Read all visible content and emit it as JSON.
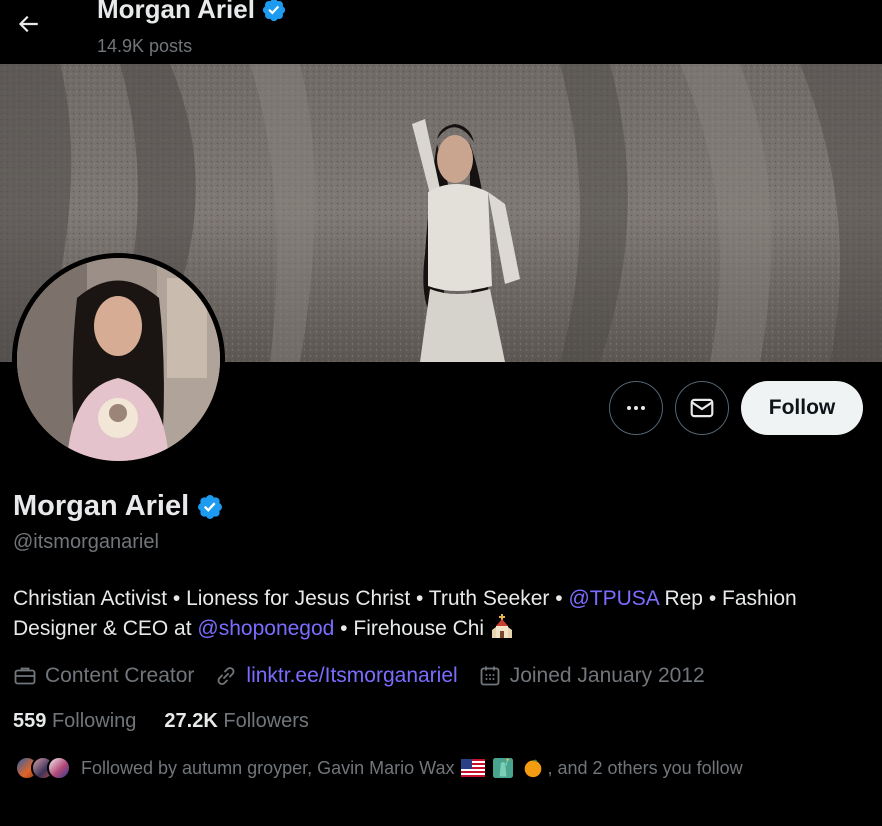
{
  "header": {
    "display_name": "Morgan Ariel",
    "posts_count": "14.9K posts"
  },
  "actions": {
    "follow_label": "Follow"
  },
  "profile": {
    "display_name": "Morgan Ariel",
    "handle": "@itsmorganariel",
    "bio": {
      "part1": "Christian Activist • Lioness for Jesus Christ • Truth Seeker • ",
      "mention1": "@TPUSA",
      "part2": " Rep • Fashion Designer & CEO at ",
      "mention2": "@shoponegod",
      "part3": " • Firehouse Chi "
    },
    "meta": {
      "category": "Content Creator",
      "link": "linktr.ee/Itsmorganariel",
      "joined": "Joined January 2012"
    },
    "stats": {
      "following_count": "559",
      "following_label": "Following",
      "followers_count": "27.2K",
      "followers_label": "Followers"
    },
    "followed_by": {
      "prefix": "Followed by autumn groyper, Gavin Mario Wax",
      "suffix": ", and 2 others you follow"
    }
  },
  "colors": {
    "background": "#000000",
    "text": "#e7e9ea",
    "secondary_text": "#71767b",
    "link": "#7b6cff",
    "verified": "#1d9bf0",
    "follow_button_bg": "#eff3f4"
  },
  "icons": {
    "back": "arrow-left-icon",
    "verified": "verified-badge-icon",
    "more": "more-horizontal-icon",
    "message": "envelope-icon",
    "category": "briefcase-icon",
    "link": "link-icon",
    "joined": "calendar-icon"
  }
}
